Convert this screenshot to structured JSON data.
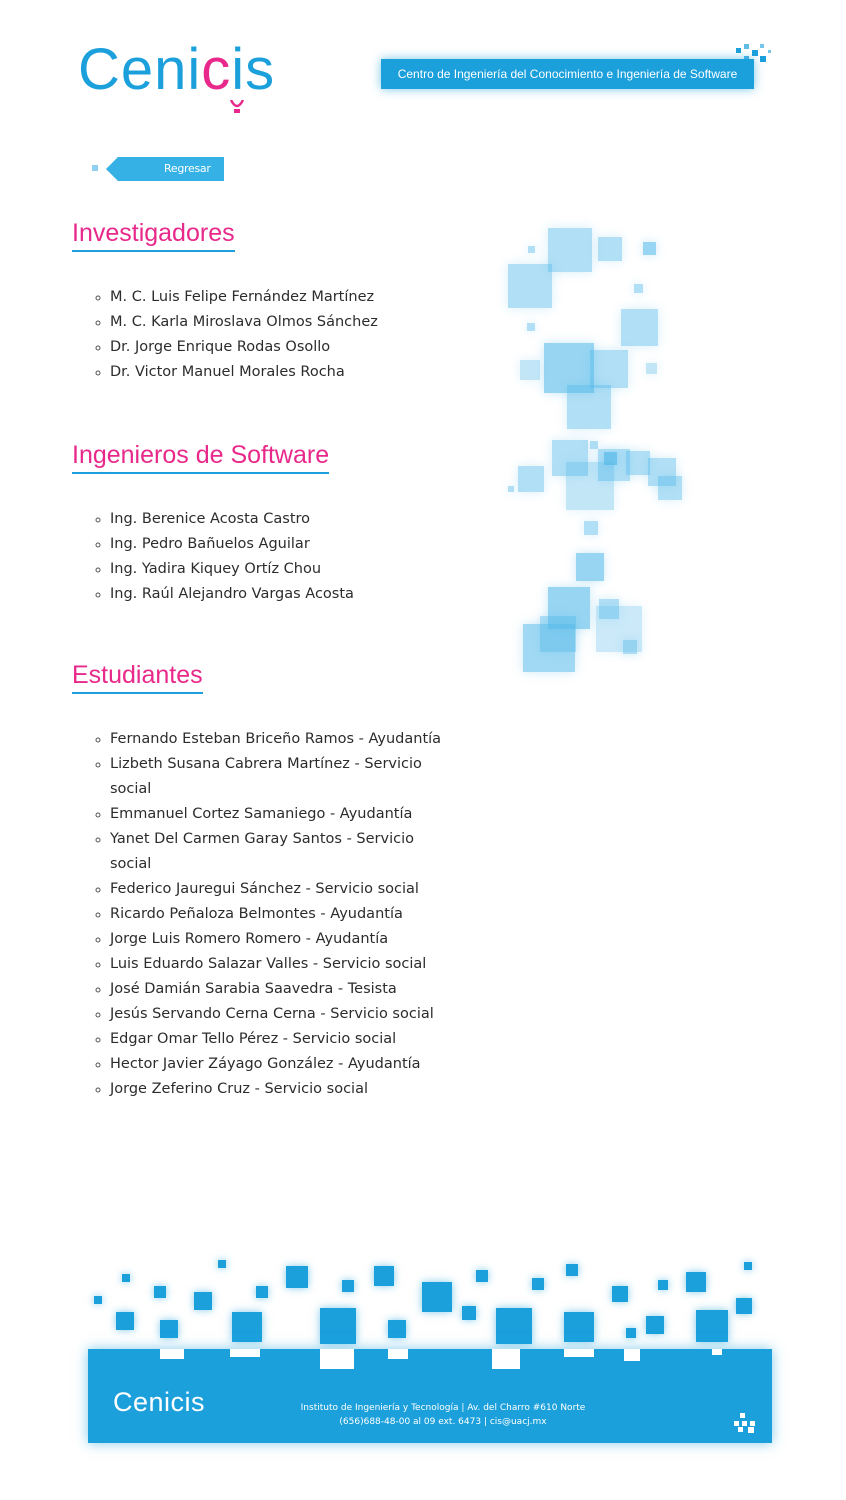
{
  "header": {
    "logo": {
      "part1": "Ceni",
      "part2": "c",
      "part3": "is"
    },
    "tagline": "Centro de Ingeniería del Conocimiento e Ingeniería de Software"
  },
  "nav": {
    "back_label": "Regresar"
  },
  "sections": {
    "investigadores": {
      "title": "Investigadores",
      "items": [
        "M. C. Luis Felipe Fernández Martínez",
        "M. C. Karla Miroslava Olmos Sánchez",
        "Dr. Jorge Enrique Rodas Osollo",
        "Dr. Victor Manuel Morales Rocha"
      ]
    },
    "ingenieros": {
      "title": "Ingenieros de Software",
      "items": [
        "Ing. Berenice Acosta Castro",
        "Ing. Pedro Bañuelos Aguilar",
        "Ing. Yadira Kiquey Ortíz Chou",
        "Ing. Raúl Alejandro Vargas Acosta"
      ]
    },
    "estudiantes": {
      "title": "Estudiantes",
      "items": [
        "Fernando Esteban Briceño Ramos - Ayudantía",
        "Lizbeth Susana Cabrera Martínez - Servicio social",
        "Emmanuel Cortez Samaniego - Ayudantía",
        "Yanet Del Carmen Garay Santos - Servicio social",
        "Federico Jauregui Sánchez - Servicio social",
        "Ricardo Peñaloza Belmontes - Ayudantía",
        "Jorge Luis Romero Romero - Ayudantía",
        "Luis Eduardo Salazar Valles - Servicio social",
        "José Damián Sarabia Saavedra - Tesista",
        "Jesús Servando Cerna Cerna - Servicio social",
        "Edgar Omar Tello Pérez - Servicio social",
        "Hector Javier Záyago González - Ayudantía",
        "Jorge Zeferino Cruz - Servicio social"
      ]
    }
  },
  "footer": {
    "logo": "Cenicis",
    "address_line": "Instituto de Ingeniería y Tecnología | Av. del Charro #610 Norte",
    "contact_line": "(656)688-48-00 al 09 ext. 6473 | cis@uacj.mx"
  },
  "colors": {
    "brand_blue": "#1ba0dc",
    "brand_pink": "#e8288a"
  }
}
